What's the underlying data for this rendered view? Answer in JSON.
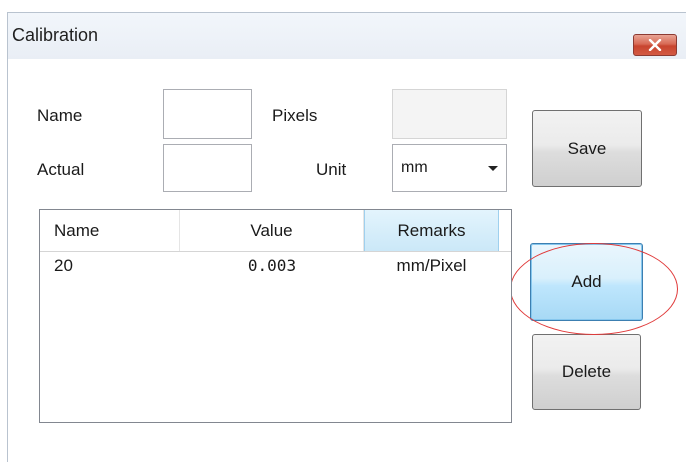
{
  "window": {
    "title": "Calibration"
  },
  "form": {
    "name_label": "Name",
    "name_value": "",
    "pixels_label": "Pixels",
    "pixels_value": "",
    "actual_label": "Actual",
    "actual_value": "",
    "unit_label": "Unit",
    "unit_selected": "mm"
  },
  "buttons": {
    "save": "Save",
    "add": "Add",
    "delete": "Delete"
  },
  "list": {
    "columns": [
      "Name",
      "Value",
      "Remarks"
    ],
    "rows": [
      {
        "name": "20",
        "value": "0.003",
        "remarks": "mm/Pixel"
      }
    ]
  },
  "colors": {
    "highlight_ring": "#e03a3a",
    "close_button": "#c8452f",
    "active_button": "#bee6fd"
  }
}
